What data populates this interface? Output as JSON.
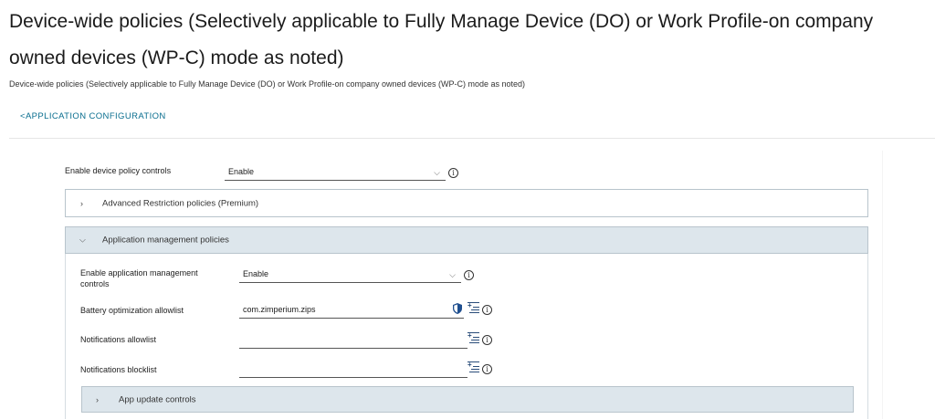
{
  "header": {
    "title": "Device-wide policies (Selectively applicable to Fully Manage Device (DO) or Work Profile-on company owned devices (WP-C) mode as noted)",
    "subtitle": "Device-wide policies (Selectively applicable to Fully Manage Device (DO) or Work Profile-on company owned devices (WP-C) mode as noted)",
    "back_link": "<APPLICATION CONFIGURATION"
  },
  "form": {
    "device_policy": {
      "label": "Enable device policy controls",
      "value": "Enable"
    },
    "advanced_section": {
      "label": "Advanced Restriction policies (Premium)",
      "expanded": false
    },
    "app_mgmt_section": {
      "label": "Application management policies",
      "expanded": true
    },
    "app_mgmt": {
      "label": "Enable application management controls",
      "value": "Enable"
    },
    "battery": {
      "label": "Battery optimization allowlist",
      "value": "com.zimperium.zips"
    },
    "notif_allow": {
      "label": "Notifications allowlist",
      "value": ""
    },
    "notif_block": {
      "label": "Notifications blocklist",
      "value": ""
    },
    "app_update_section": {
      "label": "App update controls",
      "expanded": false
    }
  },
  "icons": {
    "chevron_down": "⌵",
    "chevron_right": "›",
    "info": "i"
  },
  "colors": {
    "link": "#0a6e8f",
    "accordion_open_bg": "#dde6ec",
    "shield": "#1f4f8f"
  }
}
